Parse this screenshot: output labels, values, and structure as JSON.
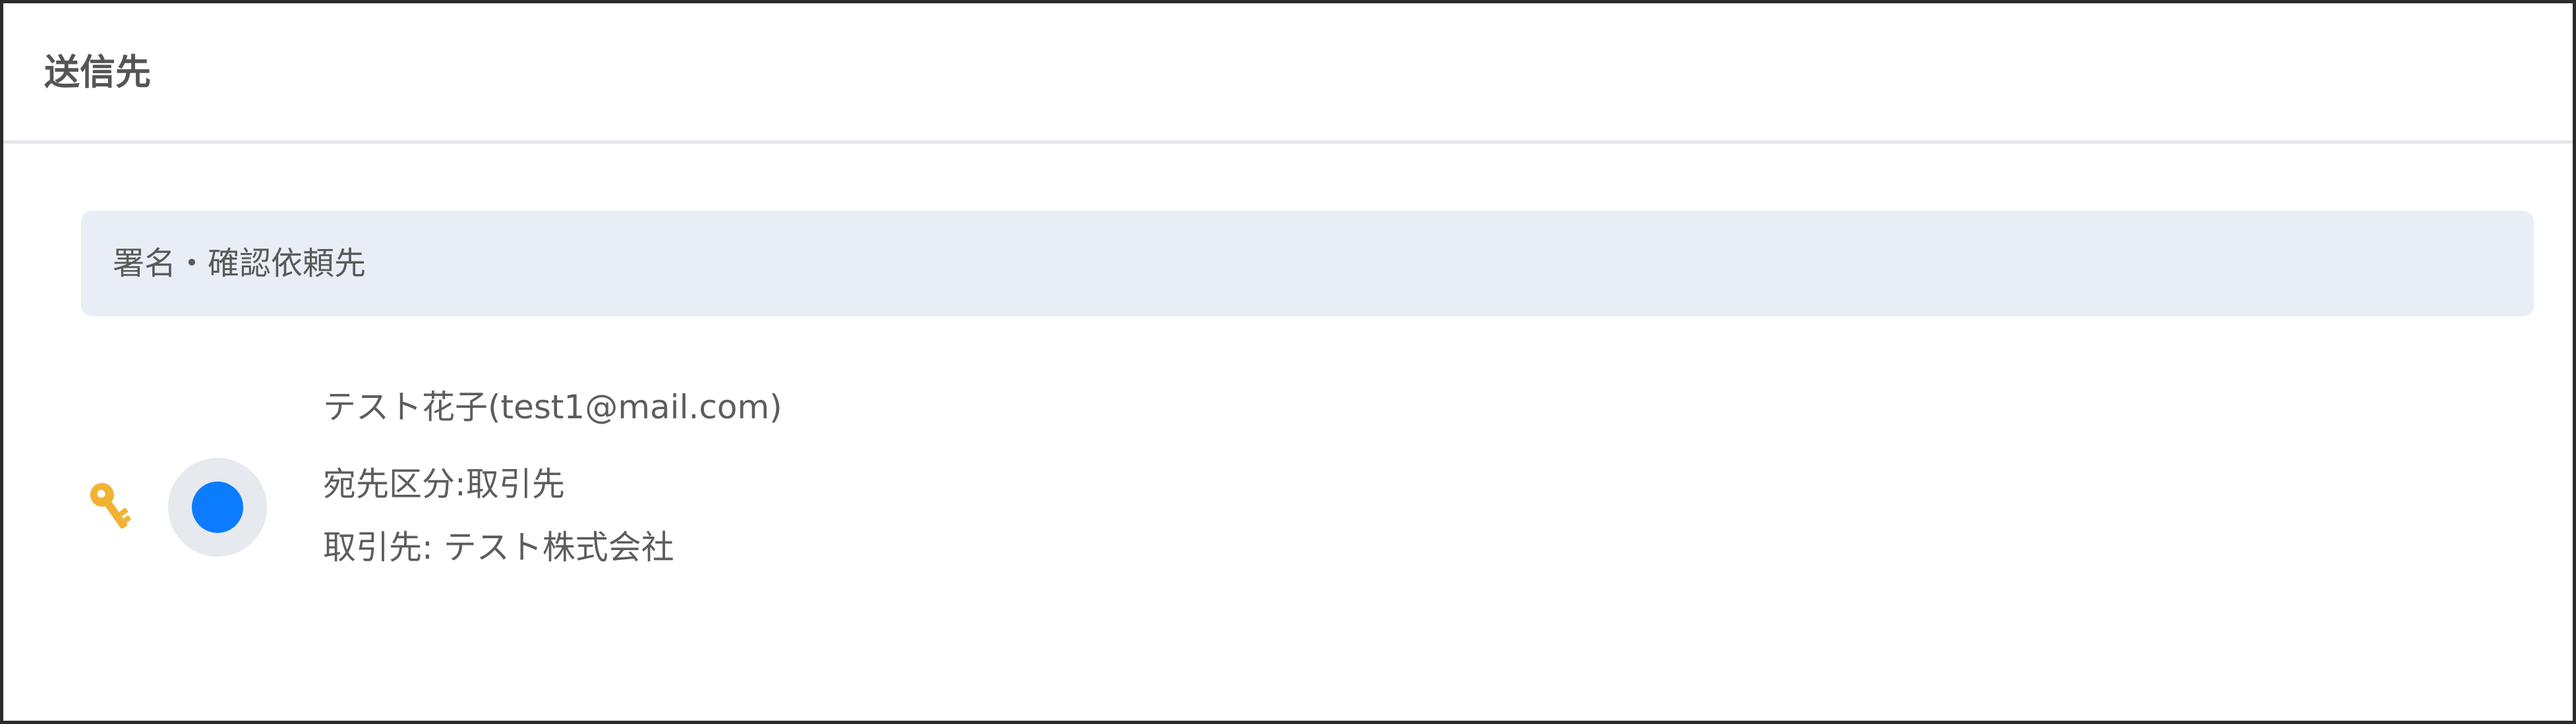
{
  "header": {
    "title": "送信先"
  },
  "section": {
    "label": "署名・確認依頼先"
  },
  "recipient": {
    "name_email": "テスト花子(test1@mail.com)",
    "type_line": "宛先区分:取引先",
    "partner_line": "取引先: テスト株式会社",
    "icons": {
      "key": "key-icon",
      "avatar": "avatar-icon"
    },
    "colors": {
      "key": "#f2b233",
      "avatar_dot": "#0b7cff",
      "avatar_bg": "#e6e9ee"
    }
  },
  "colors": {
    "section_bg": "#e9eef6",
    "divider": "#e4e6ea"
  }
}
